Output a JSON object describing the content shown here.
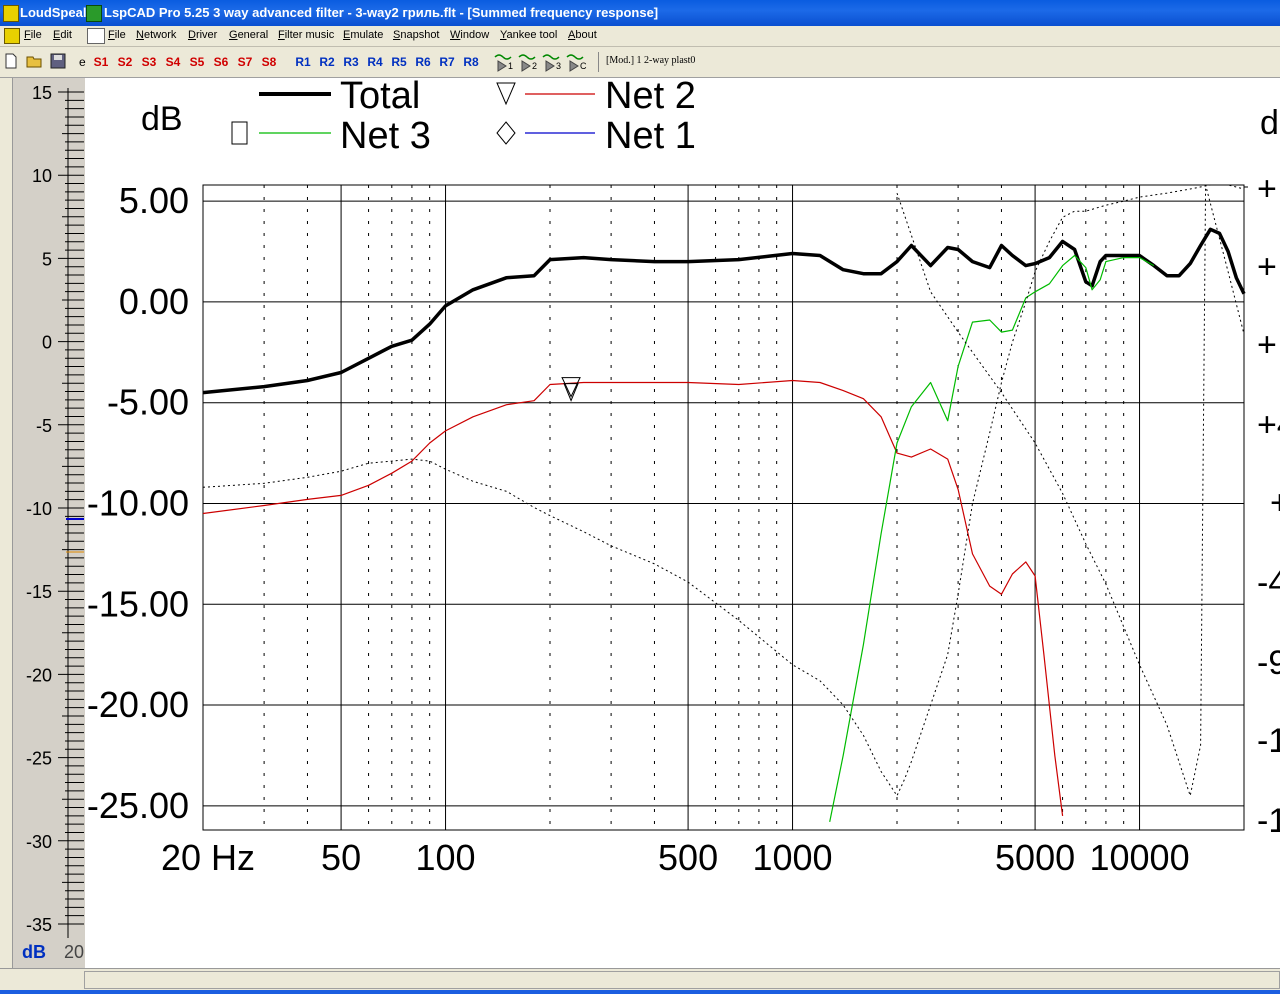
{
  "window": {
    "taskbar_title": "LoudSpeal",
    "title": "LspCAD Pro 5.25 3 way advanced filter - 3-way2 гриль.flt - [Summed frequency response]"
  },
  "menu": [
    "File",
    "Edit",
    "File",
    "Network",
    "Driver",
    "General",
    "Filter music",
    "Emulate",
    "Snapshot",
    "Window",
    "Yankee tool",
    "About"
  ],
  "toolbar": {
    "snapshots": [
      "S1",
      "S2",
      "S3",
      "S4",
      "S5",
      "S6",
      "S7",
      "S8"
    ],
    "recalls": [
      "R1",
      "R2",
      "R3",
      "R4",
      "R5",
      "R6",
      "R7",
      "R8"
    ],
    "probe_labels": [
      "1",
      "2",
      "3",
      "C"
    ],
    "model_label": "[Mod.] 1 2-way plast0",
    "stub_label": "e"
  },
  "side_axis": {
    "ticks": [
      "15",
      "10",
      "5",
      "0",
      "-5",
      "-10",
      "-15",
      "-20",
      "-25",
      "-30",
      "-35"
    ],
    "unit_label": "dB",
    "partial_label": "20"
  },
  "colors": {
    "total": "#000000",
    "net1": "#0000cc",
    "net2": "#cc0000",
    "net3": "#00bb00",
    "phase": "#000000",
    "snap_text": "#d00000",
    "recall_text": "#0030c0"
  },
  "chart_data": {
    "type": "line",
    "ylabel": "dB",
    "xscale": "log",
    "xlim": [
      20,
      20000
    ],
    "ylim": [
      -26.2,
      5.8
    ],
    "y_ticks": [
      "5.00",
      "0.00",
      "-5.00",
      "-10.00",
      "-15.00",
      "-20.00",
      "-25.00"
    ],
    "x_ticks": [
      "20 Hz",
      "50",
      "100",
      "500",
      "1000",
      "5000",
      "10000"
    ],
    "right_axis_partial_labels": [
      "d",
      "+",
      "+",
      "+",
      "+4",
      "+",
      "-4",
      "-9",
      "-1",
      "-1"
    ],
    "legend": [
      "Total",
      "Net 3",
      "Net 2",
      "Net 1"
    ],
    "legend_placement": "top",
    "grid": true,
    "series": [
      {
        "name": "Total",
        "x": [
          20,
          30,
          40,
          50,
          60,
          70,
          80,
          90,
          100,
          120,
          150,
          180,
          200,
          250,
          300,
          400,
          500,
          700,
          1000,
          1200,
          1400,
          1600,
          1800,
          2000,
          2200,
          2500,
          2800,
          3000,
          3300,
          3700,
          4000,
          4300,
          4700,
          5000,
          5500,
          6000,
          6500,
          7000,
          7300,
          7700,
          8000,
          9000,
          10000,
          11000,
          12000,
          13000,
          14000,
          15000,
          16000,
          17000,
          18000,
          19000,
          20000
        ],
        "y": [
          -4.5,
          -4.2,
          -3.9,
          -3.5,
          -2.8,
          -2.2,
          -1.9,
          -1.1,
          -0.2,
          0.6,
          1.2,
          1.3,
          2.1,
          2.2,
          2.1,
          2.0,
          2.0,
          2.1,
          2.4,
          2.3,
          1.6,
          1.4,
          1.4,
          2.0,
          2.8,
          1.8,
          2.7,
          2.6,
          2.0,
          1.7,
          2.8,
          2.3,
          1.8,
          1.9,
          2.2,
          3.0,
          2.6,
          1.0,
          0.8,
          2.0,
          2.3,
          2.3,
          2.3,
          1.8,
          1.3,
          1.3,
          1.9,
          2.8,
          3.6,
          3.4,
          2.5,
          1.2,
          0.4
        ]
      },
      {
        "name": "Net 2",
        "x": [
          20,
          30,
          40,
          50,
          60,
          70,
          80,
          90,
          100,
          120,
          150,
          180,
          200,
          250,
          300,
          400,
          500,
          700,
          1000,
          1200,
          1400,
          1600,
          1800,
          2000,
          2200,
          2500,
          2800,
          3000,
          3300,
          3700,
          4000,
          4300,
          4700,
          5000,
          5300,
          5700,
          6000
        ],
        "y": [
          -10.5,
          -10.1,
          -9.8,
          -9.6,
          -9.1,
          -8.5,
          -7.9,
          -7.0,
          -6.4,
          -5.7,
          -5.1,
          -4.9,
          -4.1,
          -4.0,
          -4.0,
          -4.0,
          -4.0,
          -4.1,
          -3.9,
          -4.0,
          -4.4,
          -4.8,
          -5.7,
          -7.5,
          -7.7,
          -7.3,
          -7.8,
          -9.3,
          -12.5,
          -14.1,
          -14.5,
          -13.5,
          -12.9,
          -13.6,
          -17.5,
          -22.5,
          -25.5
        ]
      },
      {
        "name": "Net 3",
        "x": [
          1280,
          1400,
          1600,
          1800,
          2000,
          2200,
          2500,
          2800,
          3000,
          3300,
          3700,
          4000,
          4300,
          4700,
          5000,
          5500,
          6000,
          6500,
          7000,
          7300,
          7700,
          8000,
          9000,
          10000,
          11000
        ],
        "y": [
          -25.8,
          -22.5,
          -17.0,
          -11.5,
          -7.0,
          -5.2,
          -4.0,
          -5.9,
          -3.2,
          -1.0,
          -0.9,
          -1.5,
          -1.4,
          0.2,
          0.5,
          0.9,
          1.8,
          2.3,
          1.7,
          0.6,
          1.1,
          2.0,
          2.2,
          2.2,
          1.8
        ]
      },
      {
        "name": "Phase",
        "x": [
          20,
          30,
          40,
          50,
          60,
          70,
          80,
          90,
          100,
          120,
          150,
          180,
          200,
          250,
          300,
          400,
          500,
          700,
          1000,
          1200,
          1400,
          1600,
          1800,
          2000,
          2100,
          2200,
          2500,
          2800,
          3000,
          3300,
          3700,
          4000,
          4300,
          4700,
          5000,
          5500,
          6000,
          6500,
          7000,
          8000,
          9000,
          10000,
          12000,
          14000,
          16000,
          18000,
          20000
        ],
        "y": [
          -9.2,
          -9.0,
          -8.7,
          -8.4,
          -8.0,
          -7.9,
          -7.8,
          -7.9,
          -8.3,
          -8.9,
          -9.4,
          -10.2,
          -10.6,
          -11.4,
          -12.1,
          -13.0,
          -13.9,
          -15.8,
          -18.0,
          -18.8,
          -20.0,
          -21.5,
          -23.3,
          -24.5,
          -23.7,
          -22.8,
          -20.0,
          -17.5,
          -14.5,
          -10.0,
          -6.5,
          -4.0,
          -2.0,
          0.0,
          1.5,
          3.0,
          4.2,
          4.5,
          4.5,
          4.8,
          5.0,
          5.2,
          5.4,
          5.6,
          5.8,
          5.8,
          5.6
        ]
      }
    ],
    "marker_label": "∇"
  }
}
